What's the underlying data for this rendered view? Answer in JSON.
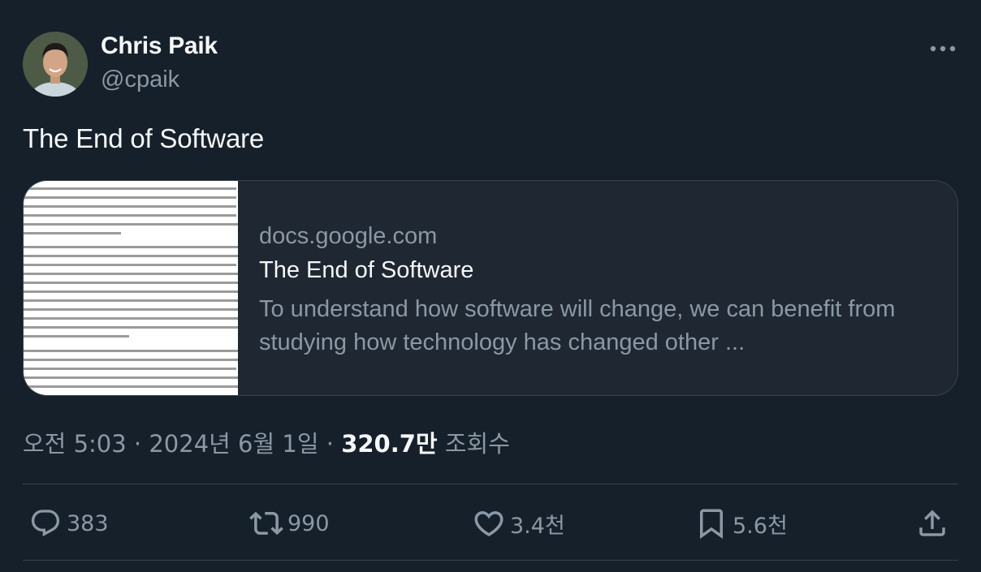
{
  "author": {
    "name": "Chris Paik",
    "handle": "@cpaik"
  },
  "tweet": {
    "text": "The End of Software"
  },
  "card": {
    "domain": "docs.google.com",
    "title": "The End of Software",
    "description": "To understand how software will change, we can benefit from studying how technology has changed other ..."
  },
  "meta": {
    "time": "오전 5:03",
    "separator": "·",
    "date": "2024년 6월 1일",
    "views_count": "320.7만",
    "views_label": "조회수"
  },
  "actions": {
    "replies": "383",
    "retweets": "990",
    "likes": "3.4천",
    "bookmarks": "5.6천"
  },
  "icons": {
    "more": "more-icon",
    "reply": "reply-icon",
    "retweet": "retweet-icon",
    "like": "heart-icon",
    "bookmark": "bookmark-icon",
    "share": "share-icon"
  },
  "colors": {
    "background": "#15202b",
    "card_background": "#1e2732",
    "border": "#38444d",
    "text_primary": "#f7f9f9",
    "text_secondary": "#8b98a5"
  }
}
